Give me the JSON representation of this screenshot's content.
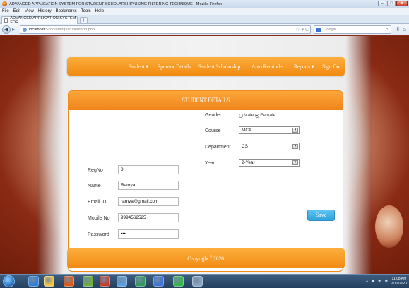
{
  "window": {
    "title": "ADVANCED APPLICATION SYSTEM FOR STUDENT SCHOLARSHIP USING FILTERING TECHNIQUE - Mozilla Firefox",
    "minimize": "–",
    "maximize": "□",
    "close": "✕"
  },
  "menu": [
    "File",
    "Edit",
    "View",
    "History",
    "Bookmarks",
    "Tools",
    "Help"
  ],
  "tab": {
    "label": "ADVANCED APPLICATION SYSTEM FOR ...",
    "new_tab": "+"
  },
  "address": {
    "host": "localhost",
    "path": "/Scholarship/studentadd.php",
    "tools": "☆ ▾ C"
  },
  "search": {
    "placeholder": "Google"
  },
  "nav": {
    "student": "Student ▾",
    "sponsor": "Sponsor Details",
    "scholarship": "Student Scholarship",
    "reminder": "Auto Reminder",
    "reports": "Reports ▾",
    "signout": "Sign Out"
  },
  "form": {
    "title": "STUDENT DETAILS",
    "regno_label": "RegNo",
    "regno_value": "3",
    "name_label": "Name",
    "name_value": "Ramya",
    "email_label": "Email ID",
    "email_value": "ramya@gmail.com",
    "mobile_label": "Mobile No",
    "mobile_value": "9994562525",
    "password_label": "Password",
    "password_value": "abc",
    "gender_label": "Gender",
    "gender_male": "Male",
    "gender_female": "Female",
    "gender_selected": "Female",
    "course_label": "Course",
    "course_value": "MCA",
    "department_label": "Department",
    "department_value": "CS",
    "year_label": "Year",
    "year_value": "2-Year",
    "save_label": "Save"
  },
  "footer": {
    "text": "Copyright",
    "symbol": "©",
    "year": "2020"
  },
  "taskbar": {
    "clock_time": "11:08 AM",
    "clock_date": "2/12/2020",
    "icon_colors": [
      "#2f7fd6",
      "#f5c542",
      "#e2560f",
      "#6fae3a",
      "#c43c2a",
      "#5aa0e0",
      "#2f9a5b",
      "#3b74d8",
      "#38b54a",
      "#8aa4c4"
    ]
  }
}
